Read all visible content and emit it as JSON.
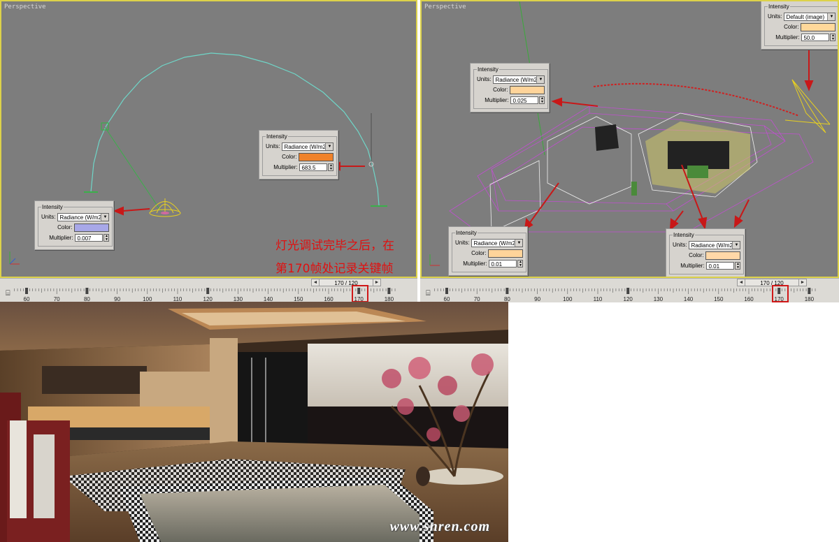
{
  "viewports": {
    "left": {
      "label": "Perspective"
    },
    "right": {
      "label": "Perspective"
    }
  },
  "panels": {
    "left_top": {
      "group": "Intensity",
      "units_label": "Units:",
      "units_value": "Radiance (W/m2/",
      "color_label": "Color:",
      "color_hex": "#f0822a",
      "multiplier_label": "Multiplier:",
      "multiplier_value": "683.5"
    },
    "left_bottom": {
      "group": "Intensity",
      "units_label": "Units:",
      "units_value": "Radiance (W/m2/",
      "color_label": "Color:",
      "color_hex": "#a8a8e8",
      "multiplier_label": "Multiplier:",
      "multiplier_value": "0.007"
    },
    "right_top_right": {
      "group": "Intensity",
      "units_label": "Units:",
      "units_value": "Default (image)",
      "color_label": "Color:",
      "color_hex": "#ffd89a",
      "multiplier_label": "Multiplier:",
      "multiplier_value": "50.0"
    },
    "right_mid": {
      "group": "Intensity",
      "units_label": "Units:",
      "units_value": "Radiance (W/m2/",
      "color_label": "Color:",
      "color_hex": "#ffd49a",
      "multiplier_label": "Multiplier:",
      "multiplier_value": "0.025"
    },
    "right_bottom_left": {
      "group": "Intensity",
      "units_label": "Units:",
      "units_value": "Radiance (W/m2/",
      "color_label": "Color:",
      "color_hex": "#ffd49a",
      "multiplier_label": "Multiplier:",
      "multiplier_value": "0.01"
    },
    "right_bottom_right": {
      "group": "Intensity",
      "units_label": "Units:",
      "units_value": "Radiance (W/m2/",
      "color_label": "Color:",
      "color_hex": "#ffd8a8",
      "multiplier_label": "Multiplier:",
      "multiplier_value": "0.01"
    }
  },
  "annotation": {
    "line1": "灯光调试完毕之后，在",
    "line2": "第170帧处记录关键帧",
    "color": "#e01010"
  },
  "timeline": {
    "left": {
      "frame_display": "170 / 120",
      "ticks": [
        "60",
        "70",
        "80",
        "90",
        "100",
        "110",
        "120",
        "130",
        "140",
        "150",
        "160",
        "170",
        "180"
      ]
    },
    "right": {
      "frame_display": "170 / 120",
      "ticks": [
        "60",
        "70",
        "80",
        "90",
        "100",
        "110",
        "120",
        "130",
        "140",
        "150",
        "160",
        "170",
        "180"
      ]
    },
    "highlight_color": "#d01818"
  },
  "render": {
    "watermark": "www.snren.com"
  },
  "icons": {
    "set_key": "key-filter-icon",
    "prev": "arrow-left-icon",
    "next": "arrow-right-icon",
    "spin": "spinner-icon"
  }
}
